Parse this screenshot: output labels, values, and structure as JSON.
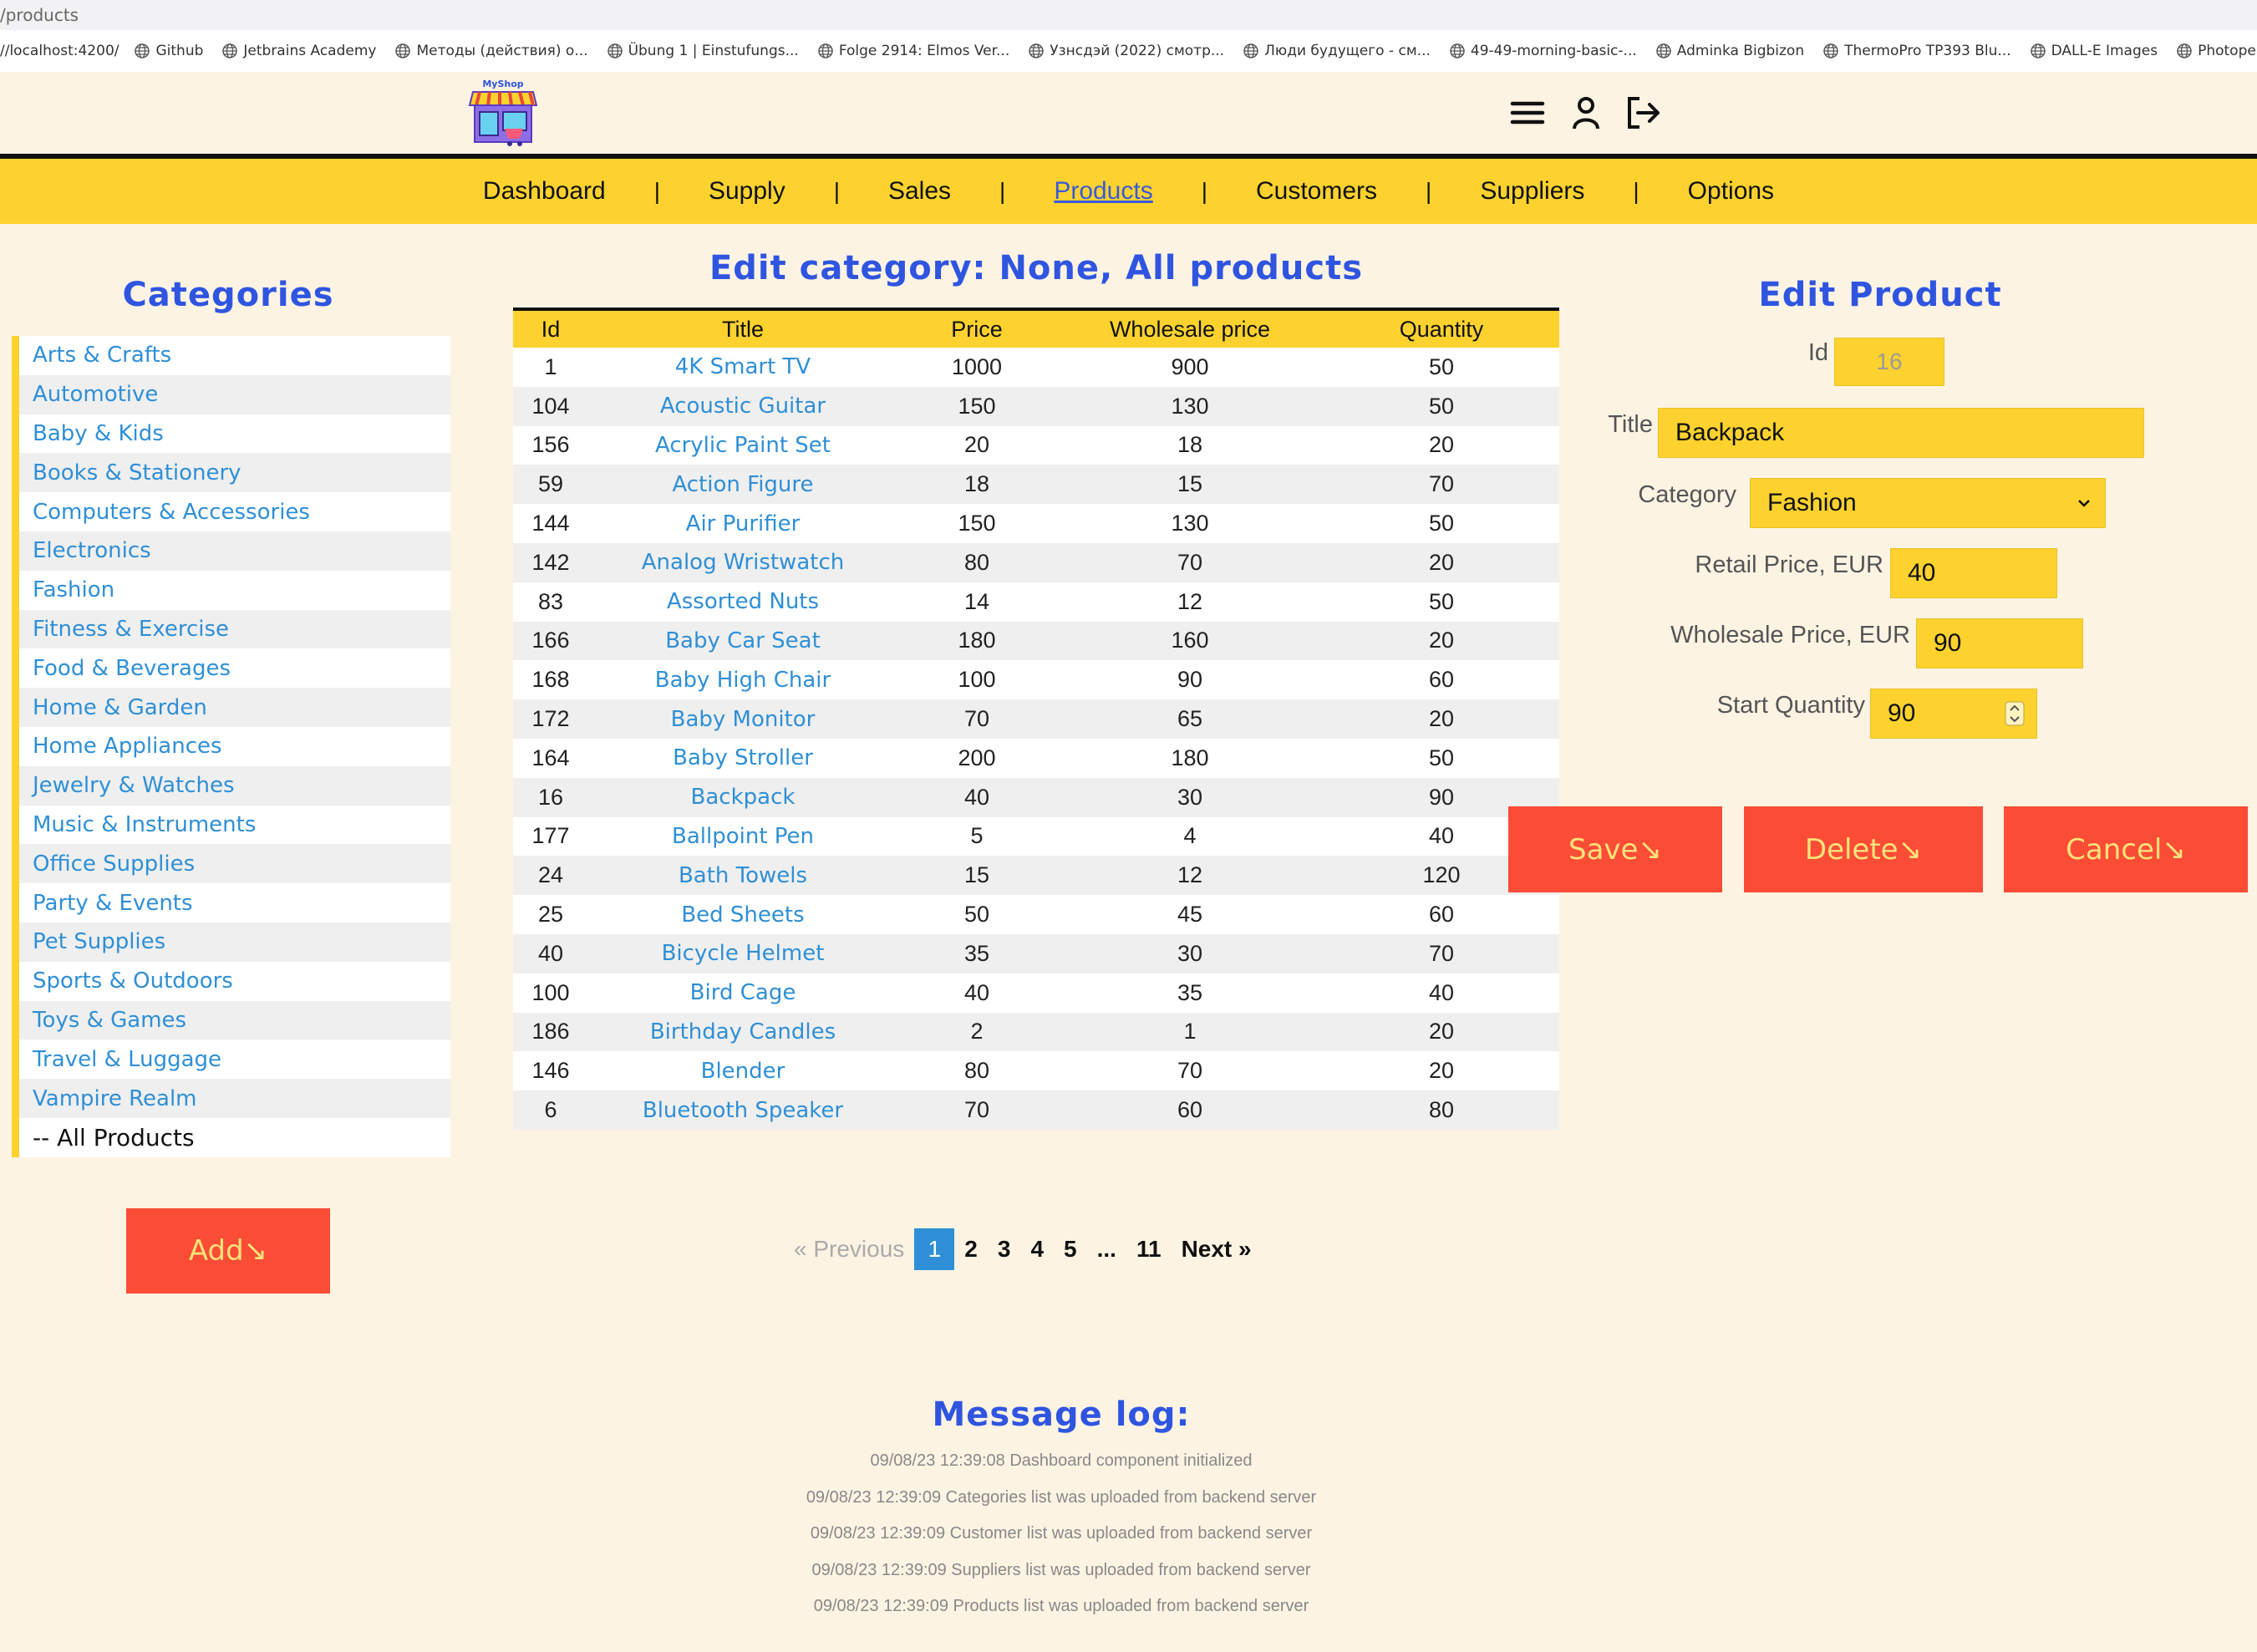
{
  "browser": {
    "url": "/products",
    "bookmarks": [
      {
        "label": "//localhost:4200/",
        "icon": "none"
      },
      {
        "label": "Github",
        "icon": "globe-icon"
      },
      {
        "label": "Jetbrains Academy",
        "icon": "globe-icon"
      },
      {
        "label": "Методы (действия) о...",
        "icon": "globe-icon"
      },
      {
        "label": "Übung 1 | Einstufungs...",
        "icon": "globe-icon"
      },
      {
        "label": "Folge 2914: Elmos Ver...",
        "icon": "globe-icon"
      },
      {
        "label": "Узнсдэй (2022) смотр...",
        "icon": "globe-icon"
      },
      {
        "label": "Люди будущего - см...",
        "icon": "globe-icon"
      },
      {
        "label": "49-49-morning-basic-...",
        "icon": "globe-icon"
      },
      {
        "label": "Adminka Bigbizon",
        "icon": "globe-icon"
      },
      {
        "label": "ThermoPro TP393 Blu...",
        "icon": "globe-icon"
      },
      {
        "label": "DALL-E Images",
        "icon": "globe-icon"
      },
      {
        "label": "Photopea | Online Pho",
        "icon": "globe-icon"
      }
    ]
  },
  "header": {
    "logo_text": "MyShop",
    "icons": [
      "menu-icon",
      "user-icon",
      "logout-icon"
    ]
  },
  "nav": {
    "items": [
      "Dashboard",
      "Supply",
      "Sales",
      "Products",
      "Customers",
      "Suppliers",
      "Options"
    ],
    "active": "Products",
    "separator": "|"
  },
  "categories": {
    "heading": "Categories",
    "items": [
      "Arts & Crafts",
      "Automotive",
      "Baby & Kids",
      "Books & Stationery",
      "Computers & Accessories",
      "Electronics",
      "Fashion",
      "Fitness & Exercise",
      "Food & Beverages",
      "Home & Garden",
      "Home Appliances",
      "Jewelry & Watches",
      "Music & Instruments",
      "Office Supplies",
      "Party & Events",
      "Pet Supplies",
      "Sports & Outdoors",
      "Toys & Games",
      "Travel & Luggage",
      "Vampire Realm"
    ],
    "all_label": "-- All Products",
    "add_label": "Add↘"
  },
  "table": {
    "heading": "Edit category: None, All products",
    "columns": [
      "Id",
      "Title",
      "Price",
      "Wholesale price",
      "Quantity"
    ],
    "rows": [
      [
        "1",
        "4K Smart TV",
        "1000",
        "900",
        "50"
      ],
      [
        "104",
        "Acoustic Guitar",
        "150",
        "130",
        "50"
      ],
      [
        "156",
        "Acrylic Paint Set",
        "20",
        "18",
        "20"
      ],
      [
        "59",
        "Action Figure",
        "18",
        "15",
        "70"
      ],
      [
        "144",
        "Air Purifier",
        "150",
        "130",
        "50"
      ],
      [
        "142",
        "Analog Wristwatch",
        "80",
        "70",
        "20"
      ],
      [
        "83",
        "Assorted Nuts",
        "14",
        "12",
        "50"
      ],
      [
        "166",
        "Baby Car Seat",
        "180",
        "160",
        "20"
      ],
      [
        "168",
        "Baby High Chair",
        "100",
        "90",
        "60"
      ],
      [
        "172",
        "Baby Monitor",
        "70",
        "65",
        "20"
      ],
      [
        "164",
        "Baby Stroller",
        "200",
        "180",
        "50"
      ],
      [
        "16",
        "Backpack",
        "40",
        "30",
        "90"
      ],
      [
        "177",
        "Ballpoint Pen",
        "5",
        "4",
        "40"
      ],
      [
        "24",
        "Bath Towels",
        "15",
        "12",
        "120"
      ],
      [
        "25",
        "Bed Sheets",
        "50",
        "45",
        "60"
      ],
      [
        "40",
        "Bicycle Helmet",
        "35",
        "30",
        "70"
      ],
      [
        "100",
        "Bird Cage",
        "40",
        "35",
        "40"
      ],
      [
        "186",
        "Birthday Candles",
        "2",
        "1",
        "20"
      ],
      [
        "146",
        "Blender",
        "80",
        "70",
        "20"
      ],
      [
        "6",
        "Bluetooth Speaker",
        "70",
        "60",
        "80"
      ]
    ]
  },
  "pagination": {
    "prev": "« Previous",
    "pages": [
      "1",
      "2",
      "3",
      "4",
      "5",
      "...",
      "11"
    ],
    "current": "1",
    "next": "Next »"
  },
  "edit_product": {
    "heading": "Edit Product",
    "id_label": "Id",
    "id_value": "16",
    "title_label": "Title",
    "title_value": "Backpack",
    "category_label": "Category",
    "category_value": "Fashion",
    "retail_label": "Retail Price, EUR",
    "retail_value": "40",
    "wholesale_label": "Wholesale Price, EUR",
    "wholesale_value": "90",
    "quantity_label": "Start Quantity",
    "quantity_value": "90",
    "save_label": "Save↘",
    "delete_label": "Delete↘",
    "cancel_label": "Cancel↘"
  },
  "log": {
    "heading": "Message log:",
    "lines": [
      "09/08/23 12:39:08 Dashboard component initialized",
      "09/08/23 12:39:09 Categories list was uploaded from backend server",
      "09/08/23 12:39:09 Customer list was uploaded from backend server",
      "09/08/23 12:39:09 Suppliers list was uploaded from backend server",
      "09/08/23 12:39:09 Products list was uploaded from backend server"
    ]
  },
  "colors": {
    "background": "#fdf3e3",
    "accent_yellow": "#fdd22e",
    "button_red": "#fb4c36",
    "heading_blue": "#2f55e0",
    "link_blue": "#2f8fd6"
  }
}
